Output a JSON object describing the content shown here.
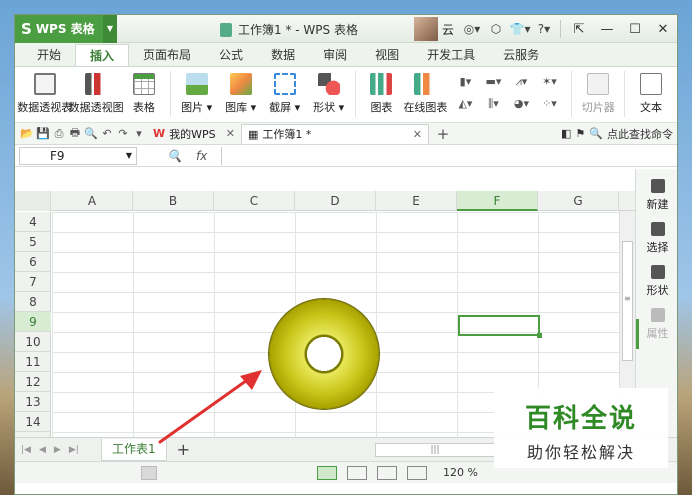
{
  "app": {
    "name": "WPS 表格",
    "window_title": "工作簿1 * - WPS 表格",
    "user": "云"
  },
  "menu_tabs": [
    "开始",
    "插入",
    "页面布局",
    "公式",
    "数据",
    "审阅",
    "视图",
    "开发工具",
    "云服务"
  ],
  "active_menu_tab": "插入",
  "ribbon": {
    "buttons": [
      {
        "label": "数据透视表",
        "icon": "pivot-table-icon"
      },
      {
        "label": "数据透视图",
        "icon": "pivot-chart-icon"
      },
      {
        "label": "表格",
        "icon": "table-icon"
      },
      {
        "label": "图片 ▾",
        "icon": "picture-icon"
      },
      {
        "label": "图库 ▾",
        "icon": "gallery-icon"
      },
      {
        "label": "截屏 ▾",
        "icon": "screenshot-icon"
      },
      {
        "label": "形状 ▾",
        "icon": "shape-icon"
      },
      {
        "label": "图表",
        "icon": "chart-icon"
      },
      {
        "label": "在线图表",
        "icon": "online-chart-icon"
      },
      {
        "label": "切片器",
        "icon": "slicer-icon"
      },
      {
        "label": "文本",
        "icon": "text-icon"
      }
    ]
  },
  "doc_tabs": {
    "mywps": "我的WPS",
    "active": "工作簿1 *",
    "search_cmd": "点此查找命令"
  },
  "formula_bar": {
    "name_box": "F9",
    "fx": "fx",
    "value": ""
  },
  "columns": [
    "A",
    "B",
    "C",
    "D",
    "E",
    "F",
    "G"
  ],
  "selected_column": "F",
  "rows": [
    "4",
    "5",
    "6",
    "7",
    "8",
    "9",
    "10",
    "11",
    "12",
    "13",
    "14",
    "15"
  ],
  "selected_row": "9",
  "right_panel": {
    "items": [
      {
        "label": "新建",
        "enabled": true
      },
      {
        "label": "选择",
        "enabled": true
      },
      {
        "label": "形状",
        "enabled": true
      },
      {
        "label": "属性",
        "enabled": false
      }
    ]
  },
  "sheet_tabs": [
    "工作表1"
  ],
  "status": {
    "zoom": "120 %"
  },
  "watermark": {
    "title": "百科全说",
    "subtitle": "助你轻松解决"
  },
  "colors": {
    "accent": "#4b9d42",
    "donut": "#c8c418",
    "annotation": "#e03030"
  }
}
